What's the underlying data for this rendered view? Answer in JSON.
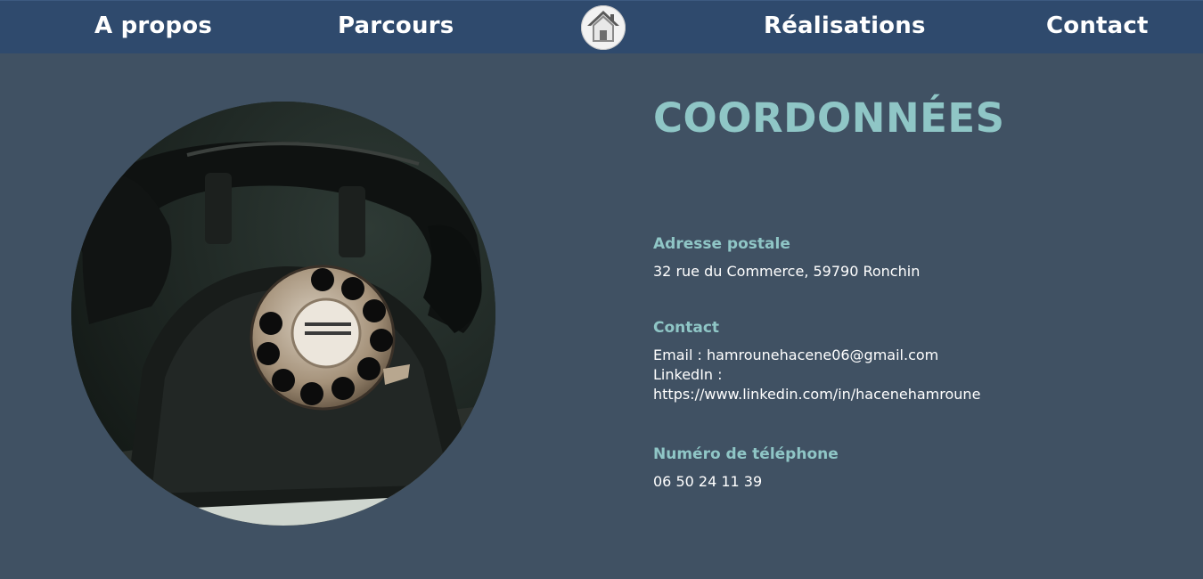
{
  "nav": {
    "items": [
      {
        "label": "A propos"
      },
      {
        "label": "Parcours"
      },
      {
        "label": "Réalisations"
      },
      {
        "label": "Contact"
      }
    ],
    "home_icon": "house-icon"
  },
  "photo": {
    "subject": "telephone-image"
  },
  "page": {
    "title": "COORDONNÉES"
  },
  "address": {
    "heading": "Adresse postale",
    "value": "32 rue du Commerce, 59790 Ronchin"
  },
  "contact": {
    "heading": "Contact",
    "email": "Email : hamrounehacene06@gmail.com",
    "linkedin_label": "LinkedIn :",
    "linkedin_url": "https://www.linkedin.com/in/hacenehamroune"
  },
  "phone": {
    "heading": "Numéro de téléphone",
    "value": "06 50 24 11 39"
  },
  "colors": {
    "navbar": "#2f4a6d",
    "background": "#405163",
    "accent": "#8fc6c6",
    "text": "#ffffff"
  }
}
